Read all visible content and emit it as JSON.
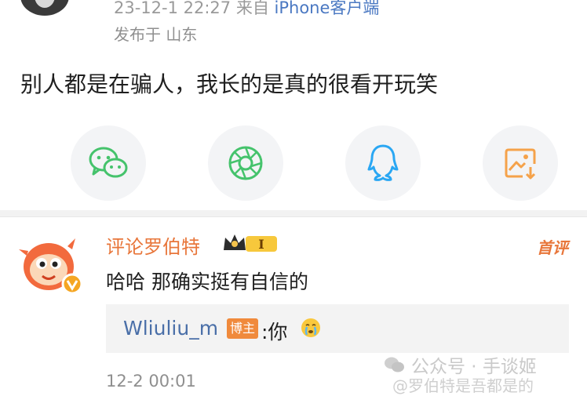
{
  "post": {
    "meta_time": "23-12-1 22:27",
    "meta_from": "来自",
    "meta_source": "iPhone客户端",
    "location": "发布于 山东",
    "text": "别人都是在骗人，我长的是真的很看开玩笑"
  },
  "share": {
    "icons": [
      "wechat-icon",
      "moments-icon",
      "qq-icon",
      "save-image-icon"
    ],
    "colors": {
      "wechat": "#45c36c",
      "moments": "#45c36c",
      "qq": "#2aa7f3",
      "save": "#f5a24a"
    }
  },
  "comment": {
    "author": "评论罗伯特",
    "level_badge": "I",
    "first_badge": "首评",
    "text": "哈哈 那确实挺有自信的",
    "reply": {
      "user": "Wliuliu_m",
      "tag": "博主",
      "text": ":你"
    },
    "time": "12-2 00:01"
  },
  "watermark": {
    "line1": "公众号 · 手谈姬",
    "line2": "@罗伯特是吾都是的"
  },
  "colors": {
    "accent": "#e8763a",
    "link": "#4a6fa8",
    "muted": "#8f8f8f"
  }
}
